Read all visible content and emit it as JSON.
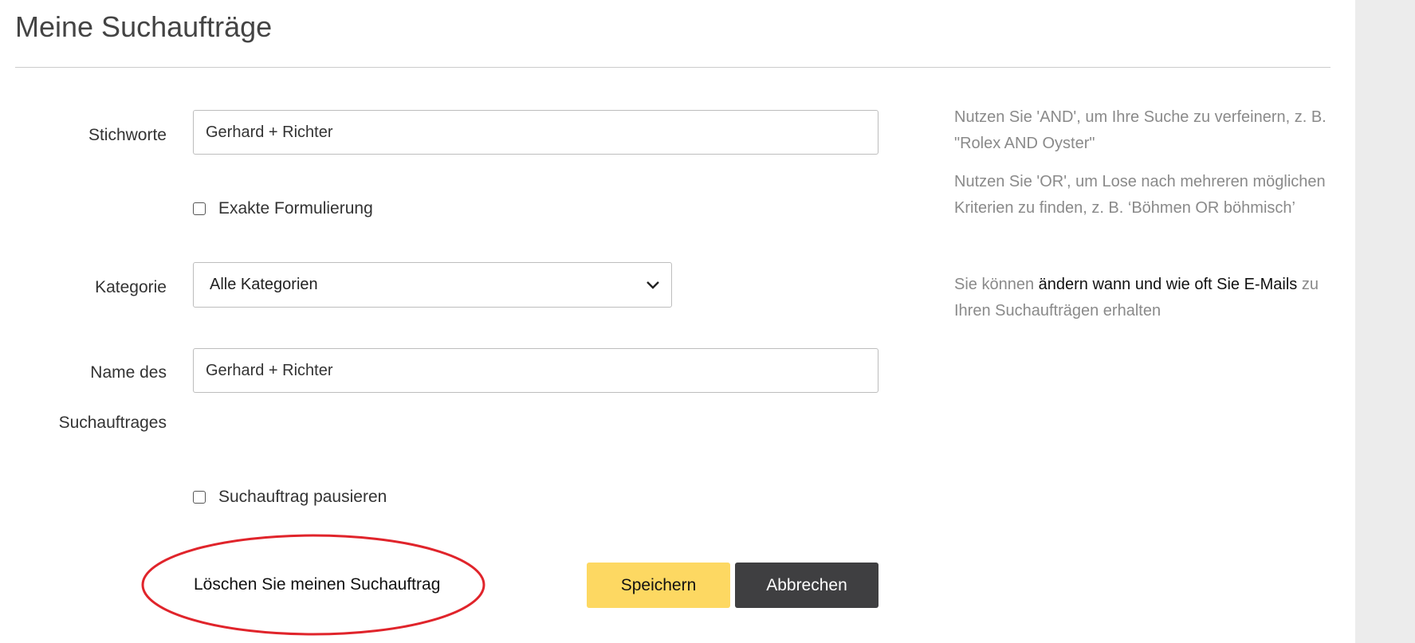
{
  "page": {
    "title": "Meine Suchaufträge"
  },
  "form": {
    "keywords_label": "Stichworte",
    "keywords_value": "Gerhard + Richter",
    "exact_label": "Exakte Formulierung",
    "exact_checked": false,
    "category_label": "Kategorie",
    "category_selected": "Alle Kategorien",
    "name_label_line1": "Name des",
    "name_label_line2": "Suchauftrages",
    "name_value": "Gerhard + Richter",
    "pause_label": "Suchauftrag pausieren",
    "pause_checked": false,
    "delete_link": "Löschen Sie meinen Suchauftrag",
    "save_button": "Speichern",
    "cancel_button": "Abbrechen"
  },
  "help": {
    "and_tip": "Nutzen Sie 'AND', um Ihre Suche zu verfeinern, z. B. \"Rolex AND Oyster\"",
    "or_tip": "Nutzen Sie 'OR', um Lose nach mehreren möglichen Kriterien zu finden, z. B. ‘Böhmen OR böhmisch’",
    "email_prefix": "Sie können",
    "email_link": "ändern wann und wie oft Sie E-Mails",
    "email_suffix": "zu Ihren Suchaufträgen erhalten"
  },
  "colors": {
    "save_button": "#fdd862",
    "cancel_button": "#3f3f41",
    "annotation_circle": "#e0242b"
  },
  "icons": {
    "category_dropdown": "chevron-down-icon"
  }
}
